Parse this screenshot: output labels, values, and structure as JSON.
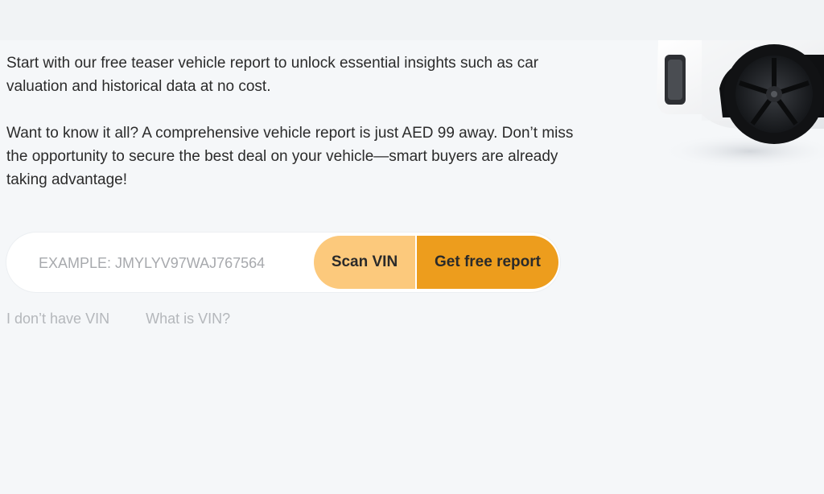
{
  "intro": {
    "paragraph_1": "Start with our free teaser vehicle report to unlock essential insights such as car valuation and historical data at no cost.",
    "paragraph_2": "Want to know it all? A comprehensive vehicle report is just AED 99 away. Don’t miss the opportunity to secure the best deal on your vehicle—smart buyers are already taking advantage!"
  },
  "vin_form": {
    "placeholder": "EXAMPLE: JMYLYV97WAJ767564",
    "value": "",
    "scan_label": "Scan VIN",
    "submit_label": "Get free report"
  },
  "links": {
    "no_vin": "I don’t have VIN",
    "what_is_vin": "What is VIN?"
  },
  "colors": {
    "scan_button": "#fcc97c",
    "submit_button": "#ed9d1d",
    "background": "#f5f7f9"
  },
  "image": {
    "icon": "car-image"
  }
}
